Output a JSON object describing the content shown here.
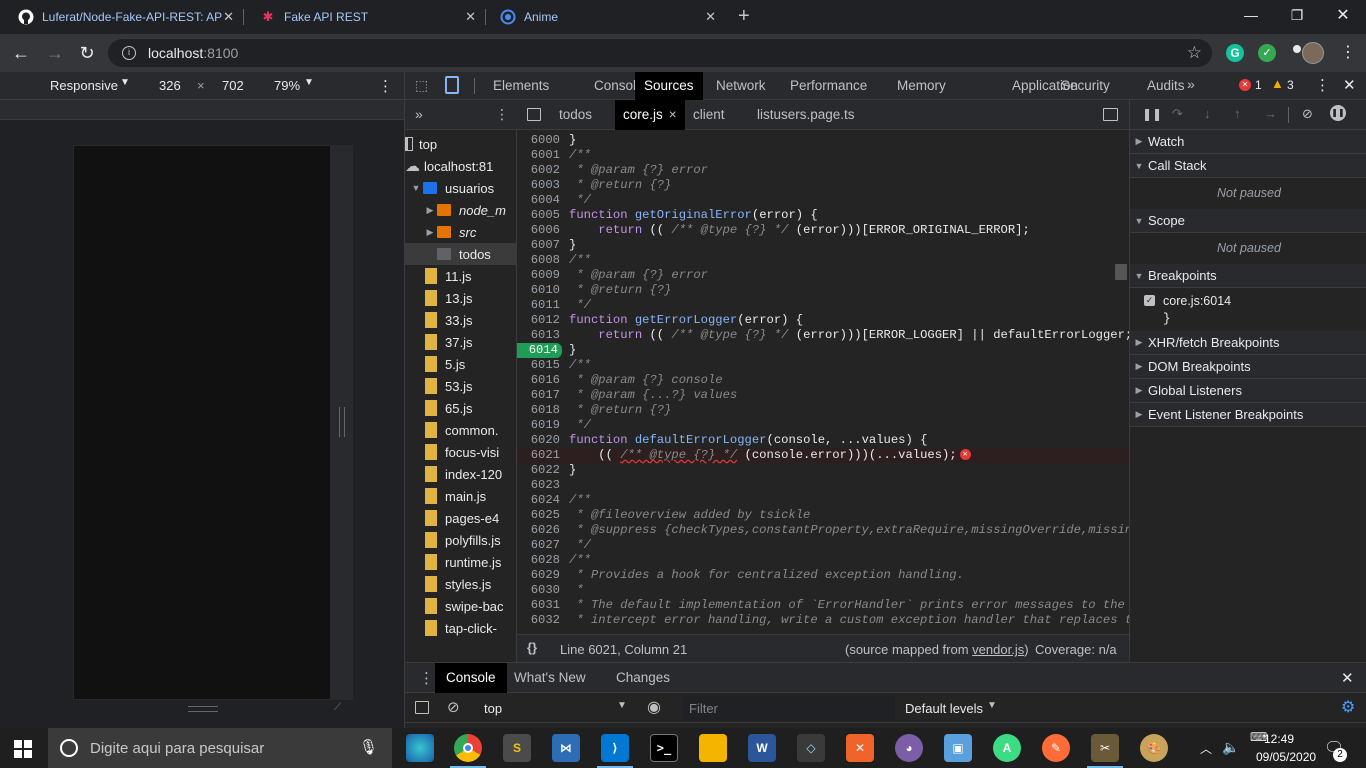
{
  "browser": {
    "tabs": [
      {
        "title": "Luferat/Node-Fake-API-REST: AP",
        "icon": "github-icon"
      },
      {
        "title": "Fake API REST",
        "icon": "ionic-icon"
      },
      {
        "title": "Anime",
        "icon": "ionic-circle-icon"
      }
    ],
    "new_tab": "+",
    "url_host": "localhost",
    "url_port": ":8100"
  },
  "device_toolbar": {
    "mode": "Responsive",
    "width": "326",
    "times": "×",
    "height": "702",
    "zoom": "79%"
  },
  "devtools": {
    "tabs": [
      "Elements",
      "Console",
      "Sources",
      "Network",
      "Performance",
      "Memory",
      "Application",
      "Security",
      "Audits"
    ],
    "active_tab": "Sources",
    "more": "»",
    "error_count": "1",
    "warning_count": "3",
    "navigator": {
      "items": [
        {
          "label": "top",
          "kind": "frame",
          "indent": 0
        },
        {
          "label": "localhost:81",
          "kind": "cloud",
          "indent": 0
        },
        {
          "label": "usuarios",
          "kind": "folder",
          "indent": 1
        },
        {
          "label": "node_m",
          "kind": "folder-orange",
          "indent": 2,
          "italic": true
        },
        {
          "label": "src",
          "kind": "folder-orange",
          "indent": 2,
          "italic": true
        },
        {
          "label": "todos",
          "kind": "folder-gray",
          "indent": 2,
          "selected": true
        },
        {
          "label": "11.js",
          "kind": "file",
          "indent": 1
        },
        {
          "label": "13.js",
          "kind": "file",
          "indent": 1
        },
        {
          "label": "33.js",
          "kind": "file",
          "indent": 1
        },
        {
          "label": "37.js",
          "kind": "file",
          "indent": 1
        },
        {
          "label": "5.js",
          "kind": "file",
          "indent": 1
        },
        {
          "label": "53.js",
          "kind": "file",
          "indent": 1
        },
        {
          "label": "65.js",
          "kind": "file",
          "indent": 1
        },
        {
          "label": "common.",
          "kind": "file",
          "indent": 1
        },
        {
          "label": "focus-visi",
          "kind": "file",
          "indent": 1
        },
        {
          "label": "index-120",
          "kind": "file",
          "indent": 1
        },
        {
          "label": "main.js",
          "kind": "file",
          "indent": 1
        },
        {
          "label": "pages-e4",
          "kind": "file",
          "indent": 1
        },
        {
          "label": "polyfills.js",
          "kind": "file",
          "indent": 1
        },
        {
          "label": "runtime.js",
          "kind": "file",
          "indent": 1
        },
        {
          "label": "styles.js",
          "kind": "file",
          "indent": 1
        },
        {
          "label": "swipe-bac",
          "kind": "file",
          "indent": 1
        },
        {
          "label": "tap-click-",
          "kind": "file",
          "indent": 1
        }
      ]
    },
    "editor": {
      "tabs": [
        {
          "label": "todos"
        },
        {
          "label": "core.js",
          "active": true,
          "close": "×"
        },
        {
          "label": "client"
        },
        {
          "label": "listusers.page.ts"
        }
      ],
      "lines": [
        {
          "n": "6000",
          "t": "}"
        },
        {
          "n": "6001",
          "t": "/**",
          "c": "cm"
        },
        {
          "n": "6002",
          "t": " * @param {?} error",
          "c": "cm"
        },
        {
          "n": "6003",
          "t": " * @return {?}",
          "c": "cm"
        },
        {
          "n": "6004",
          "t": " */",
          "c": "cm"
        },
        {
          "n": "6005",
          "t": "function getOriginalError(error) {",
          "c": "fn"
        },
        {
          "n": "6006",
          "t": "    return (( /** @type {?} */ (error)))[ERROR_ORIGINAL_ERROR];"
        },
        {
          "n": "6007",
          "t": "}"
        },
        {
          "n": "6008",
          "t": "/**",
          "c": "cm"
        },
        {
          "n": "6009",
          "t": " * @param {?} error",
          "c": "cm"
        },
        {
          "n": "6010",
          "t": " * @return {?}",
          "c": "cm"
        },
        {
          "n": "6011",
          "t": " */",
          "c": "cm"
        },
        {
          "n": "6012",
          "t": "function getErrorLogger(error) {",
          "c": "fn"
        },
        {
          "n": "6013",
          "t": "    return (( /** @type {?} */ (error)))[ERROR_LOGGER] || defaultErrorLogger;"
        },
        {
          "n": "6014",
          "t": "}",
          "bp": true
        },
        {
          "n": "6015",
          "t": "/**",
          "c": "cm"
        },
        {
          "n": "6016",
          "t": " * @param {?} console",
          "c": "cm"
        },
        {
          "n": "6017",
          "t": " * @param {...?} values",
          "c": "cm"
        },
        {
          "n": "6018",
          "t": " * @return {?}",
          "c": "cm"
        },
        {
          "n": "6019",
          "t": " */",
          "c": "cm"
        },
        {
          "n": "6020",
          "t": "function defaultErrorLogger(console, ...values) {",
          "c": "fn"
        },
        {
          "n": "6021",
          "t": "    (( /** @type {?} */ (console.error)))(...values);",
          "err": true
        },
        {
          "n": "6022",
          "t": "}"
        },
        {
          "n": "6023",
          "t": ""
        },
        {
          "n": "6024",
          "t": "/**",
          "c": "cm"
        },
        {
          "n": "6025",
          "t": " * @fileoverview added by tsickle",
          "c": "cm"
        },
        {
          "n": "6026",
          "t": " * @suppress {checkTypes,constantProperty,extraRequire,missingOverride,missing",
          "c": "cm"
        },
        {
          "n": "6027",
          "t": " */",
          "c": "cm"
        },
        {
          "n": "6028",
          "t": "/**",
          "c": "cm"
        },
        {
          "n": "6029",
          "t": " * Provides a hook for centralized exception handling.",
          "c": "cm"
        },
        {
          "n": "6030",
          "t": " *",
          "c": "cm"
        },
        {
          "n": "6031",
          "t": " * The default implementation of `ErrorHandler` prints error messages to the",
          "c": "cm"
        },
        {
          "n": "6032",
          "t": " * intercept error handling, write a custom exception handler that replaces t",
          "c": "cm"
        }
      ],
      "status_position": "Line 6021, Column 21",
      "source_mapped_prefix": "(source mapped from ",
      "source_mapped_file": "vendor.js",
      "source_mapped_suffix": ")",
      "coverage": "Coverage: n/a",
      "pretty_print": "{}"
    },
    "debugger": {
      "sections": [
        {
          "label": "Watch",
          "open": false
        },
        {
          "label": "Call Stack",
          "open": true,
          "note": "Not paused"
        },
        {
          "label": "Scope",
          "open": true,
          "note": "Not paused"
        },
        {
          "label": "Breakpoints",
          "open": true
        },
        {
          "label": "XHR/fetch Breakpoints",
          "open": false
        },
        {
          "label": "DOM Breakpoints",
          "open": false
        },
        {
          "label": "Global Listeners",
          "open": false
        },
        {
          "label": "Event Listener Breakpoints",
          "open": false
        }
      ],
      "breakpoint_label": "core.js:6014",
      "breakpoint_code": "}"
    },
    "drawer": {
      "tabs": [
        "Console",
        "What's New",
        "Changes"
      ],
      "context": "top",
      "filter_placeholder": "Filter",
      "levels": "Default levels"
    }
  },
  "taskbar": {
    "search_placeholder": "Digite aqui para pesquisar",
    "time": "12:49",
    "date": "09/05/2020",
    "notification_count": "2"
  }
}
